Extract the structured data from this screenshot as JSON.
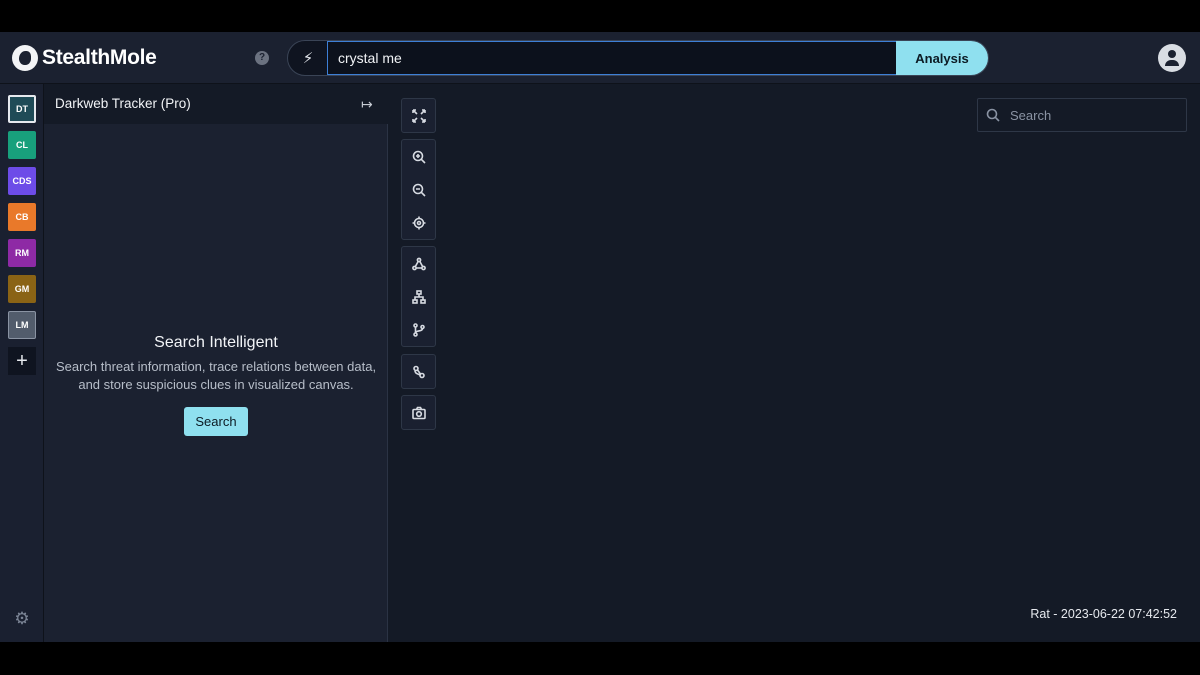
{
  "header": {
    "brand": "StealthMole",
    "query_value": "crystal me",
    "analysis_label": "Analysis",
    "help_glyph": "?",
    "bolt_glyph": "⚡"
  },
  "rail": {
    "items": [
      {
        "label": "DT",
        "color": "#1f4b57",
        "border": "#e6e9ee"
      },
      {
        "label": "CL",
        "color": "#18a07c",
        "border": "#18a07c"
      },
      {
        "label": "CDS",
        "color": "#6d4ce8",
        "border": "#6d4ce8"
      },
      {
        "label": "CB",
        "color": "#e9792a",
        "border": "#e9792a"
      },
      {
        "label": "RM",
        "color": "#8e2aa5",
        "border": "#8e2aa5"
      },
      {
        "label": "GM",
        "color": "#8a6315",
        "border": "#8a6315"
      },
      {
        "label": "LM",
        "color": "#525c6c",
        "border": "#6b7280"
      }
    ],
    "add_glyph": "+",
    "settings_glyph": "⚙"
  },
  "panel": {
    "title": "Darkweb Tracker (Pro)",
    "collapse_glyph": "↦",
    "empty_title": "Search Intelligent",
    "empty_desc": "Search threat information, trace relations between data, and store suspicious clues in visualized canvas.",
    "search_button": "Search"
  },
  "canvas": {
    "search_placeholder": "Search",
    "status": "Rat - 2023-06-22 07:42:52",
    "tools": [
      "fit-screen-icon",
      "zoom-in-icon",
      "zoom-out-icon",
      "center-target-icon",
      "network-layout-icon",
      "hierarchy-layout-icon",
      "branch-layout-icon",
      "link-icon",
      "camera-icon"
    ]
  }
}
